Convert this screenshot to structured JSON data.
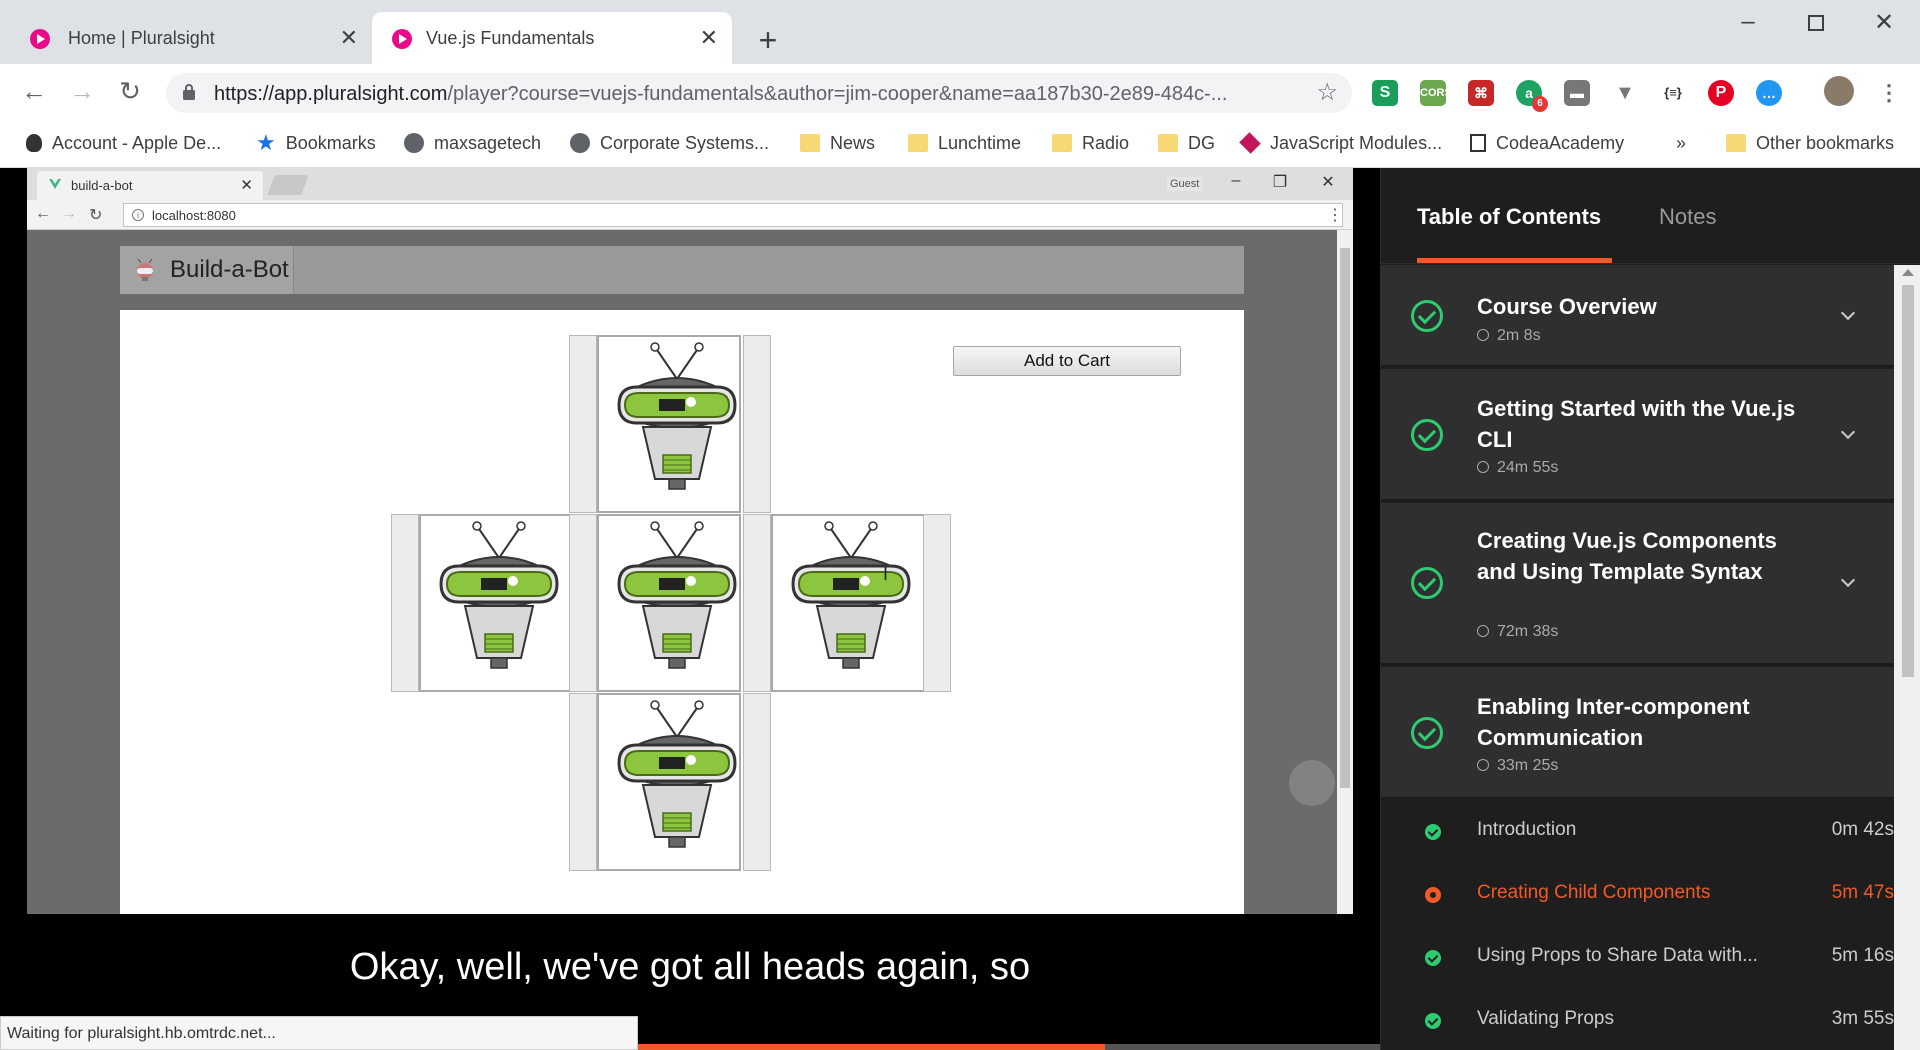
{
  "browser": {
    "tabs": [
      {
        "label": "Home | Pluralsight"
      },
      {
        "label": "Vue.js Fundamentals"
      }
    ],
    "url_host": "https://app.pluralsight.com",
    "url_rest": "/player?course=vuejs-fundamentals&author=jim-cooper&name=aa187b30-2e89-484c-...",
    "bookmarks": [
      {
        "label": "Account - Apple De..."
      },
      {
        "label": "Bookmarks"
      },
      {
        "label": "maxsagetech"
      },
      {
        "label": "Corporate Systems..."
      },
      {
        "label": "News"
      },
      {
        "label": "Lunchtime"
      },
      {
        "label": "Radio"
      },
      {
        "label": "DG"
      },
      {
        "label": "JavaScript Modules..."
      },
      {
        "label": "CodeaAcademy"
      },
      {
        "label": "»"
      },
      {
        "label": "Other bookmarks"
      }
    ],
    "extension_badge": "6",
    "ext_cors": "CORS",
    "ext_json": "{≡}"
  },
  "inner_browser": {
    "tab_label": "build-a-bot",
    "guest_label": "Guest",
    "url": "localhost:8080"
  },
  "app": {
    "brand": "Build-a-Bot",
    "add_to_cart": "Add to Cart"
  },
  "player": {
    "caption": "Okay, well, we've got all heads again, so",
    "status": "Waiting for pluralsight.hb.omtrdc.net...",
    "progress": 0.63
  },
  "sidebar": {
    "tab_toc": "Table of Contents",
    "tab_notes": "Notes",
    "modules": [
      {
        "title": "Course Overview",
        "duration": "2m 8s"
      },
      {
        "title": "Getting Started with the Vue.js CLI",
        "duration": "24m 55s"
      },
      {
        "title": "Creating Vue.js Components and Using Template Syntax",
        "duration": "72m 38s"
      },
      {
        "title": "Enabling Inter-component Communication",
        "duration": "33m 25s"
      }
    ],
    "clips": [
      {
        "title": "Introduction",
        "duration": "0m 42s"
      },
      {
        "title": "Creating Child Components",
        "duration": "5m 47s"
      },
      {
        "title": "Using Props to Share Data with...",
        "duration": "5m 16s"
      },
      {
        "title": "Validating Props",
        "duration": "3m 55s"
      }
    ]
  },
  "colors": {
    "accent": "#f05a28",
    "complete": "#2ecc71",
    "robot_green": "#8cc63f"
  }
}
